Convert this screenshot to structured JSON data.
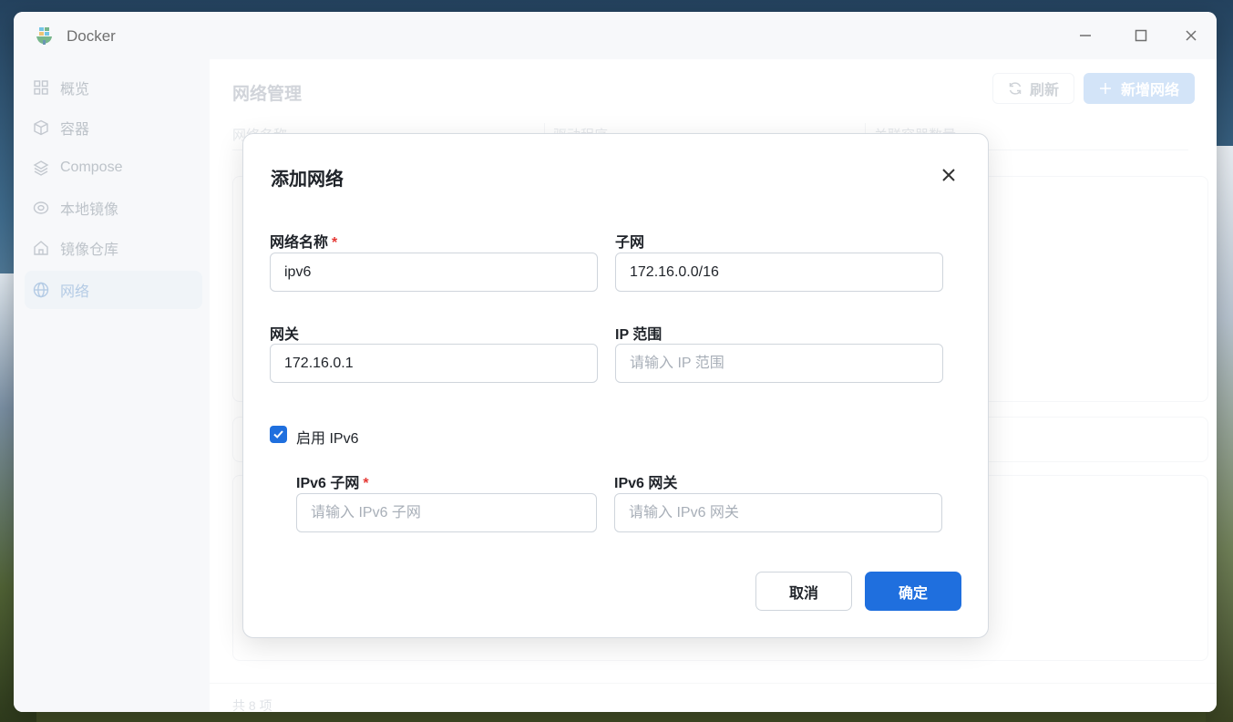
{
  "window": {
    "title": "Docker",
    "app_icon": "docker-whale-icon",
    "controls": [
      "minimize-icon",
      "maximize-icon",
      "close-icon"
    ]
  },
  "sidebar": {
    "items": [
      {
        "label": "概览",
        "icon": "grid-icon",
        "active": false
      },
      {
        "label": "容器",
        "icon": "cube-icon",
        "active": false
      },
      {
        "label": "Compose",
        "icon": "layers-icon",
        "active": false
      },
      {
        "label": "本地镜像",
        "icon": "disc-icon",
        "active": false
      },
      {
        "label": "镜像仓库",
        "icon": "home-icon",
        "active": false
      },
      {
        "label": "网络",
        "icon": "globe-icon",
        "active": true
      }
    ]
  },
  "main": {
    "title": "网络管理",
    "refresh_label": "刷新",
    "new_network_label": "新增网络",
    "table_headers": [
      "网络名称",
      "驱动程序",
      "关联容器数量"
    ],
    "footer_count": "共 8 项"
  },
  "dialog": {
    "title": "添加网络",
    "fields": {
      "network_name": {
        "label": "网络名称",
        "required": true,
        "value": "ipv6",
        "placeholder": ""
      },
      "subnet": {
        "label": "子网",
        "required": false,
        "value": "172.16.0.0/16",
        "placeholder": ""
      },
      "gateway": {
        "label": "网关",
        "required": false,
        "value": "172.16.0.1",
        "placeholder": ""
      },
      "ip_range": {
        "label": "IP 范围",
        "required": false,
        "value": "",
        "placeholder": "请输入 IP 范围"
      },
      "ipv6_subnet": {
        "label": "IPv6 子网",
        "required": true,
        "value": "",
        "placeholder": "请输入 IPv6 子网"
      },
      "ipv6_gateway": {
        "label": "IPv6 网关",
        "required": false,
        "value": "",
        "placeholder": "请输入 IPv6 网关"
      }
    },
    "enable_ipv6": {
      "label": "启用 IPv6",
      "checked": true
    },
    "cancel_label": "取消",
    "confirm_label": "确定"
  },
  "colors": {
    "primary": "#1f6fde",
    "required_star": "#e53935",
    "sidebar_bg": "#f3f5f8"
  }
}
